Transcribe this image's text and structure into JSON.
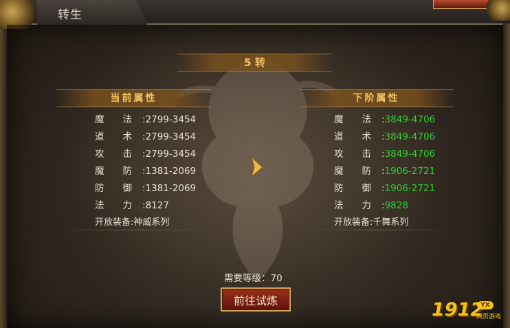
{
  "window": {
    "title": "转生"
  },
  "rebirth": {
    "level_label": "5 转"
  },
  "current": {
    "header": "当前属性",
    "attrs": [
      {
        "name": "魔　　法",
        "value": "2799-3454"
      },
      {
        "name": "道　　术",
        "value": "2799-3454"
      },
      {
        "name": "攻　　击",
        "value": "2799-3454"
      },
      {
        "name": "魔　　防",
        "value": "1381-2069"
      },
      {
        "name": "防　　御",
        "value": "1381-2069"
      },
      {
        "name": "法　　力",
        "value": "8127"
      }
    ],
    "equip_label": "开放装备:",
    "equip_value": "神威系列"
  },
  "next": {
    "header": "下阶属性",
    "attrs": [
      {
        "name": "魔　　法",
        "value": "3849-4706"
      },
      {
        "name": "道　　术",
        "value": "3849-4706"
      },
      {
        "name": "攻　　击",
        "value": "3849-4706"
      },
      {
        "name": "魔　　防",
        "value": "1906-2721"
      },
      {
        "name": "防　　御",
        "value": "1906-2721"
      },
      {
        "name": "法　　力",
        "value": "9828"
      }
    ],
    "equip_label": "开放装备:",
    "equip_value": "千舞系列"
  },
  "requirement": {
    "label": "需要等级：",
    "value": "70"
  },
  "action": {
    "button_label": "前往试炼"
  },
  "watermark": {
    "text": "1912",
    "badge": "YX",
    "sub": "网页游戏"
  },
  "colors": {
    "highlight_value": "#2cd22a",
    "banner_text": "#f2c460",
    "button_bg": "#7a2212"
  }
}
